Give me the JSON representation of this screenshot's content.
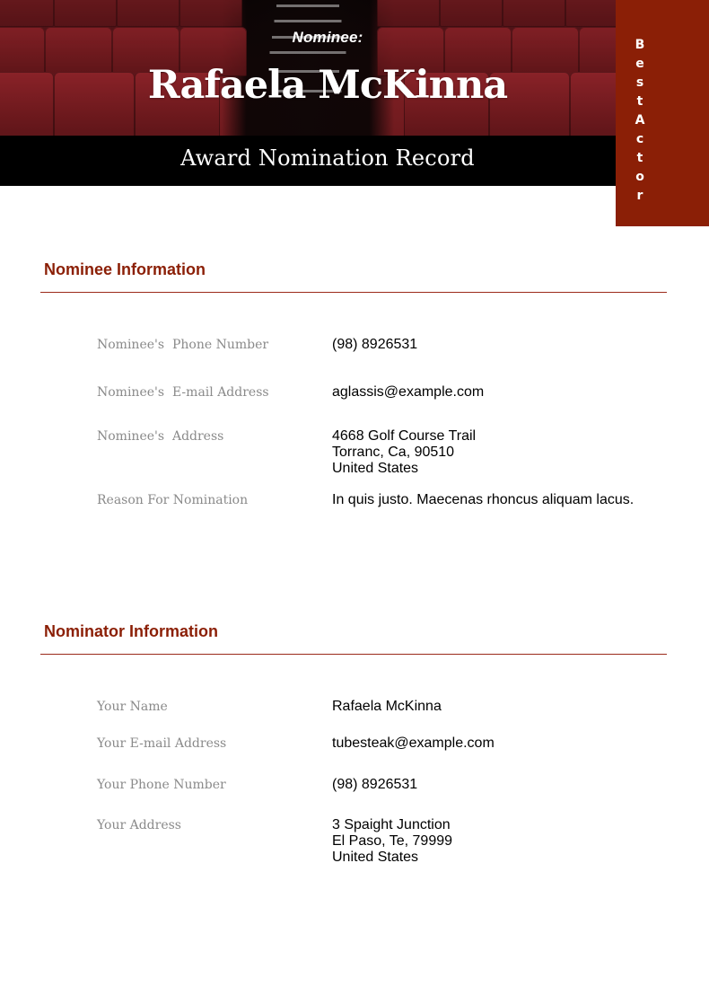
{
  "header": {
    "label": "Nominee:",
    "nominee_name": "Rafaela McKinna",
    "document_title": "Award Nomination Record",
    "category_ribbon": [
      "B",
      "e",
      "s",
      "t",
      "A",
      "c",
      "t",
      "o",
      "r"
    ],
    "colors": {
      "accent": "#8b1f06",
      "band": "#000000"
    }
  },
  "nominee_section": {
    "title": "Nominee Information",
    "fields": [
      {
        "label": "Nominee's  Phone Number",
        "value_lines": [
          "(98) 8926531"
        ]
      },
      {
        "label": "Nominee's  E-mail Address",
        "value_lines": [
          "aglassis@example.com"
        ]
      },
      {
        "label": "Nominee's  Address",
        "value_lines": [
          "4668 Golf Course Trail",
          "Torranc, Ca, 90510",
          "United States"
        ]
      },
      {
        "label": "Reason For Nomination",
        "value_lines": [
          "In quis justo. Maecenas rhoncus aliquam lacus."
        ]
      }
    ]
  },
  "nominator_section": {
    "title": "Nominator Information",
    "fields": [
      {
        "label": "Your Name",
        "value_lines": [
          "Rafaela McKinna"
        ]
      },
      {
        "label": "Your E-mail Address",
        "value_lines": [
          "tubesteak@example.com"
        ]
      },
      {
        "label": "Your Phone Number",
        "value_lines": [
          "(98) 8926531"
        ]
      },
      {
        "label": "Your Address",
        "value_lines": [
          "3 Spaight Junction",
          "El Paso, Te, 79999",
          "United States"
        ]
      }
    ]
  }
}
